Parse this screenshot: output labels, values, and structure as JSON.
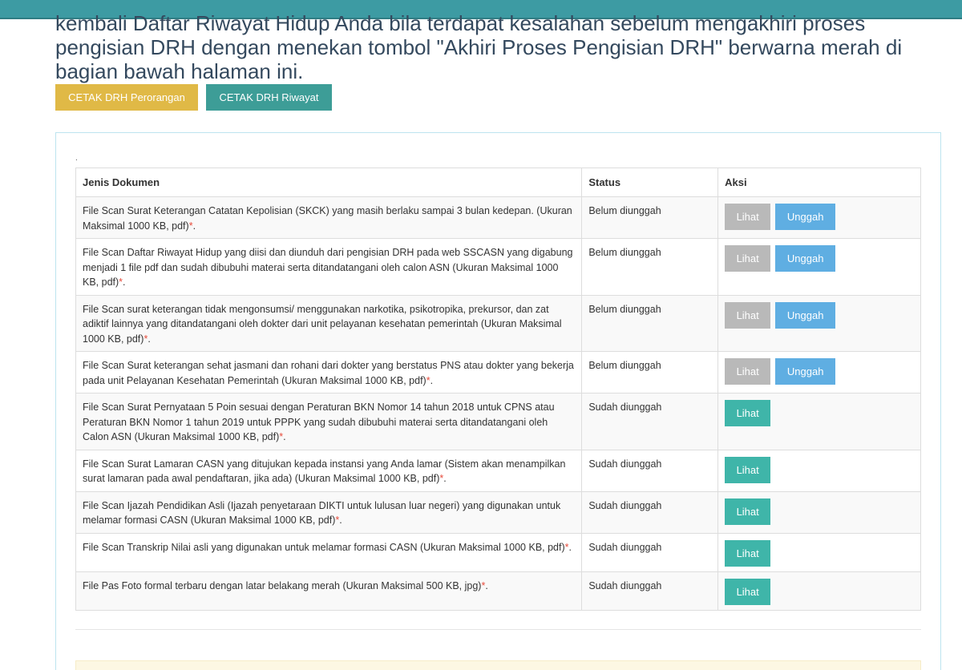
{
  "intro": {
    "line1": "kembali Daftar Riwayat Hidup Anda bila terdapat kesalahan sebelum mengakhiri proses",
    "line2": "pengisian DRH dengan menekan tombol \"Akhiri Proses Pengisian DRH\" berwarna merah di",
    "line3": "bagian bawah halaman ini."
  },
  "buttons": {
    "cetak_perorangan": "CETAK DRH Perorangan",
    "cetak_riwayat": "CETAK DRH Riwayat"
  },
  "panel": {
    "dot": "."
  },
  "table": {
    "headers": {
      "jenis": "Jenis Dokumen",
      "status": "Status",
      "aksi": "Aksi"
    },
    "required_mark": "*",
    "lihat_label": "Lihat",
    "unggah_label": "Unggah",
    "rows": [
      {
        "doc": "File Scan Surat Keterangan Catatan Kepolisian (SKCK) yang masih berlaku sampai 3 bulan kedepan. (Ukuran Maksimal 1000 KB, pdf)",
        "status": "Belum diunggah",
        "uploaded": false
      },
      {
        "doc": "File Scan Daftar Riwayat Hidup yang diisi dan diunduh dari pengisian DRH pada web SSCASN yang digabung menjadi 1 file pdf dan sudah dibubuhi materai serta ditandatangani oleh calon ASN (Ukuran Maksimal 1000 KB, pdf)",
        "status": "Belum diunggah",
        "uploaded": false
      },
      {
        "doc": "File Scan surat keterangan tidak mengonsumsi/ menggunakan narkotika, psikotropika, prekursor, dan zat adiktif lainnya yang ditandatangani oleh dokter dari unit pelayanan kesehatan pemerintah (Ukuran Maksimal 1000 KB, pdf)",
        "status": "Belum diunggah",
        "uploaded": false
      },
      {
        "doc": "File Scan Surat keterangan sehat jasmani dan rohani dari dokter yang berstatus PNS atau dokter yang bekerja pada unit Pelayanan Kesehatan Pemerintah (Ukuran Maksimal 1000 KB, pdf)",
        "status": "Belum diunggah",
        "uploaded": false
      },
      {
        "doc": "File Scan Surat Pernyataan 5 Poin sesuai dengan Peraturan BKN Nomor 14 tahun 2018 untuk CPNS atau Peraturan BKN Nomor 1 tahun 2019 untuk PPPK yang sudah dibubuhi materai serta ditandatangani oleh Calon ASN (Ukuran Maksimal 1000 KB, pdf)",
        "status": "Sudah diunggah",
        "uploaded": true
      },
      {
        "doc": "File Scan Surat Lamaran CASN yang ditujukan kepada instansi yang Anda lamar (Sistem akan menampilkan surat lamaran pada awal pendaftaran, jika ada) (Ukuran Maksimal 1000 KB, pdf)",
        "status": "Sudah diunggah",
        "uploaded": true
      },
      {
        "doc": "File Scan Ijazah Pendidikan Asli (Ijazah penyetaraan DIKTI untuk lulusan luar negeri) yang digunakan untuk melamar formasi CASN (Ukuran Maksimal 1000 KB, pdf)",
        "status": "Sudah diunggah",
        "uploaded": true
      },
      {
        "doc": "File Scan Transkrip Nilai asli yang digunakan untuk melamar formasi CASN (Ukuran Maksimal 1000 KB, pdf)",
        "status": "Sudah diunggah",
        "uploaded": true
      },
      {
        "doc": "File Pas Foto formal terbaru dengan latar belakang merah (Ukuran Maksimal 500 KB, jpg)",
        "status": "Sudah diunggah",
        "uploaded": true
      }
    ]
  },
  "colors": {
    "topbar": "#3d9ba3",
    "cetak_perorangan": "#e0b946",
    "cetak_riwayat": "#3d9d97",
    "lihat_disabled": "#b9b9b9",
    "unggah": "#5faee2",
    "lihat_active": "#3fb5a9",
    "required": "#e74c3c"
  }
}
